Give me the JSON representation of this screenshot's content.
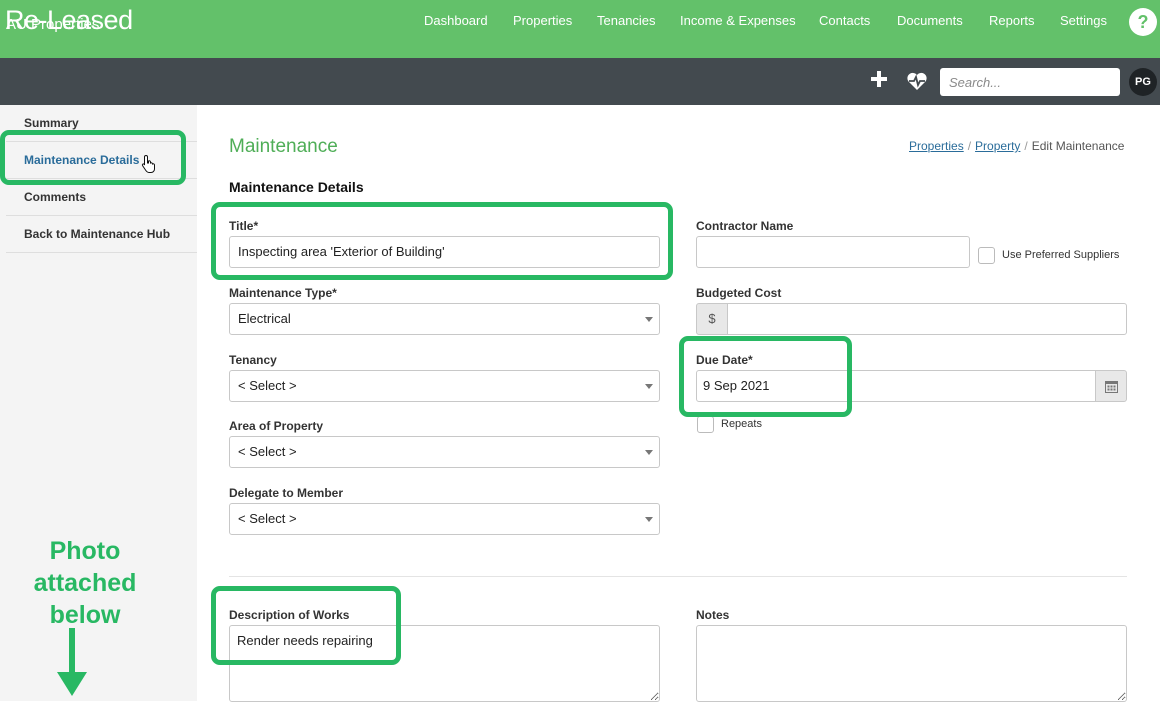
{
  "brand": {
    "logo": "Re-Leased",
    "accent": "#63c16a",
    "dark_bar": "#434a4f",
    "highlight": "#28b863"
  },
  "nav": {
    "items": [
      "Dashboard",
      "Properties",
      "Tenancies",
      "Income & Expenses",
      "Contacts",
      "Documents",
      "Reports",
      "Settings"
    ],
    "help_label": "?"
  },
  "subbar": {
    "title": "AU Properties",
    "search_placeholder": "Search...",
    "avatar": "PG",
    "icons": [
      "plus-icon",
      "heartbeat-icon"
    ]
  },
  "sidebar": {
    "items": [
      {
        "label": "Summary"
      },
      {
        "label": "Maintenance Details"
      },
      {
        "label": "Comments"
      },
      {
        "label": "Back to Maintenance Hub"
      }
    ],
    "active_index": 1
  },
  "page": {
    "title": "Maintenance",
    "breadcrumb": {
      "link1": "Properties",
      "link2": "Property",
      "current": "Edit Maintenance",
      "separator": "/"
    },
    "section": "Maintenance Details"
  },
  "form": {
    "title": {
      "label": "Title*",
      "value": "Inspecting area 'Exterior of Building'"
    },
    "contractor": {
      "label": "Contractor Name",
      "value": "",
      "checkbox_label": "Use Preferred Suppliers"
    },
    "maintenance_type": {
      "label": "Maintenance Type*",
      "value": "Electrical"
    },
    "budgeted_cost": {
      "label": "Budgeted Cost",
      "prefix": "$",
      "value": ""
    },
    "tenancy": {
      "label": "Tenancy",
      "value": "< Select >"
    },
    "due_date": {
      "label": "Due Date*",
      "value": "9 Sep 2021",
      "repeats_label": "Repeats"
    },
    "area": {
      "label": "Area of Property",
      "value": "< Select >"
    },
    "delegate": {
      "label": "Delegate to Member",
      "value": "< Select >"
    },
    "description": {
      "label": "Description of Works",
      "value": "Render needs repairing"
    },
    "notes": {
      "label": "Notes",
      "value": ""
    }
  },
  "annotation": {
    "line1": "Photo",
    "line2": "attached",
    "line3": "below"
  }
}
